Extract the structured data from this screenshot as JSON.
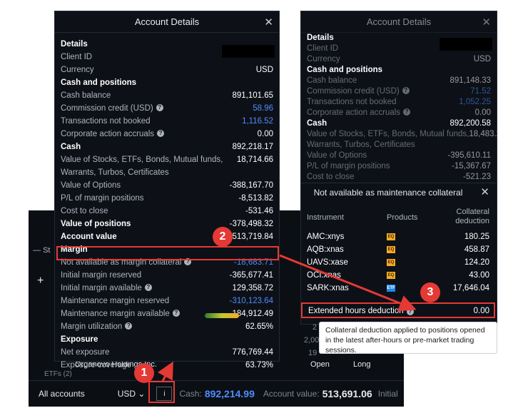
{
  "left_panel": {
    "title": "Account Details",
    "sections": [
      {
        "kind": "head",
        "label": "Details",
        "value": ""
      },
      {
        "kind": "row",
        "label": "Client ID",
        "value": ""
      },
      {
        "kind": "row",
        "label": "Currency",
        "value": "USD"
      },
      {
        "kind": "head",
        "label": "Cash and positions",
        "value": ""
      },
      {
        "kind": "row",
        "label": "Cash balance",
        "value": "891,101.65"
      },
      {
        "kind": "row",
        "label": "Commission credit (USD)",
        "value": "58.96",
        "help": true,
        "blue": true
      },
      {
        "kind": "row",
        "label": "Transactions not booked",
        "value": "1,116.52",
        "blue": true
      },
      {
        "kind": "row",
        "label": "Corporate action accruals",
        "value": "0.00",
        "help": true
      },
      {
        "kind": "head",
        "label": "Cash",
        "value": "892,218.17"
      },
      {
        "kind": "row",
        "label": "Value of Stocks, ETFs, Bonds, Mutual funds,",
        "value": "18,714.66"
      },
      {
        "kind": "row",
        "label": "Warrants, Turbos, Certificates",
        "value": ""
      },
      {
        "kind": "row",
        "label": "Value of Options",
        "value": "-388,167.70"
      },
      {
        "kind": "row",
        "label": "P/L of margin positions",
        "value": "-8,513.82"
      },
      {
        "kind": "row",
        "label": "Cost to close",
        "value": "-531.46"
      },
      {
        "kind": "head",
        "label": "Value of positions",
        "value": "-378,498.32"
      },
      {
        "kind": "head",
        "label": "Account value",
        "value": "513,719.84"
      },
      {
        "kind": "head",
        "label": "Margin",
        "value": ""
      },
      {
        "kind": "row",
        "label": "Not available as margin collateral",
        "value": "-18,683.71",
        "help": true,
        "blue": true
      },
      {
        "kind": "row",
        "label": "Initial margin reserved",
        "value": "-365,677.41"
      },
      {
        "kind": "row",
        "label": "Initial margin available",
        "value": "129,358.72",
        "help": true
      },
      {
        "kind": "row",
        "label": "Maintenance margin reserved",
        "value": "-310,123.64",
        "blue": true
      },
      {
        "kind": "row",
        "label": "Maintenance margin available",
        "value": "184,912.49",
        "help": true
      },
      {
        "kind": "row",
        "label": "Margin utilization",
        "value": "62.65%",
        "help": true
      },
      {
        "kind": "head",
        "label": "Exposure",
        "value": ""
      },
      {
        "kind": "row",
        "label": "Net exposure",
        "value": "776,769.44"
      },
      {
        "kind": "row",
        "label": "Exposure coverage",
        "value": "63.73%"
      }
    ]
  },
  "right_panel": {
    "title": "Account Details",
    "sections": [
      {
        "kind": "head",
        "label": "Details",
        "value": ""
      },
      {
        "kind": "row",
        "label": "Client ID",
        "value": ""
      },
      {
        "kind": "row",
        "label": "Currency",
        "value": "USD"
      },
      {
        "kind": "head",
        "label": "Cash and positions",
        "value": ""
      },
      {
        "kind": "row",
        "label": "Cash balance",
        "value": "891,148.33"
      },
      {
        "kind": "row",
        "label": "Commission credit (USD)",
        "value": "71.52",
        "help": true,
        "blue": true
      },
      {
        "kind": "row",
        "label": "Transactions not booked",
        "value": "1,052.25",
        "blue": true
      },
      {
        "kind": "row",
        "label": "Corporate action accruals",
        "value": "0.00",
        "help": true
      },
      {
        "kind": "head",
        "label": "Cash",
        "value": "892,200.58"
      },
      {
        "kind": "row",
        "label": "Value of Stocks, ETFs, Bonds, Mutual funds,",
        "value": "18,483.26"
      },
      {
        "kind": "row",
        "label": "Warrants, Turbos, Certificates",
        "value": ""
      },
      {
        "kind": "row",
        "label": "Value of Options",
        "value": "-395,610.11"
      },
      {
        "kind": "row",
        "label": "P/L of margin positions",
        "value": "-15,367.67"
      },
      {
        "kind": "row",
        "label": "Cost to close",
        "value": "-521.23"
      }
    ],
    "subpanel_title": "Not available as maintenance collateral",
    "columns": [
      "Instrument",
      "Products",
      "Collateral deduction"
    ],
    "instruments": [
      {
        "name": "AMC:xnys",
        "product": "EQ",
        "deduction": "180.25"
      },
      {
        "name": "AQB:xnas",
        "product": "EQ",
        "deduction": "458.87"
      },
      {
        "name": "UAVS:xase",
        "product": "EQ",
        "deduction": "124.20"
      },
      {
        "name": "OCI:xnas",
        "product": "EQ",
        "deduction": "43.00"
      },
      {
        "name": "SARK:xnas",
        "product": "ETF",
        "deduction": "17,646.04"
      }
    ],
    "extended_label": "Extended hours deduction",
    "extended_value": "0.00"
  },
  "tooltip_text": "Collateral deduction applied to positions opened in the latest after-hours or pre-market trading sessions.",
  "bottom_bar": {
    "account_select": "All accounts",
    "currency_select": "USD",
    "info_button": "i",
    "cash_label": "Cash:",
    "cash_value": "892,214.99",
    "account_value_label": "Account value:",
    "account_value": "513,691.06",
    "initial_label": "Initial"
  },
  "background_fragments": {
    "st_label": "St",
    "etfs_label": "ETFs (2)",
    "org_label": "Organovo Holdings Inc.",
    "open_label": "Open",
    "long_label": "Long",
    "bg_numbers": [
      "2",
      "2,00",
      "19"
    ]
  },
  "callouts": [
    "1",
    "2",
    "3"
  ],
  "colors": {
    "accent_blue": "#4f8cff",
    "callout_red": "#e53935",
    "panel_bg": "#0d1117"
  }
}
